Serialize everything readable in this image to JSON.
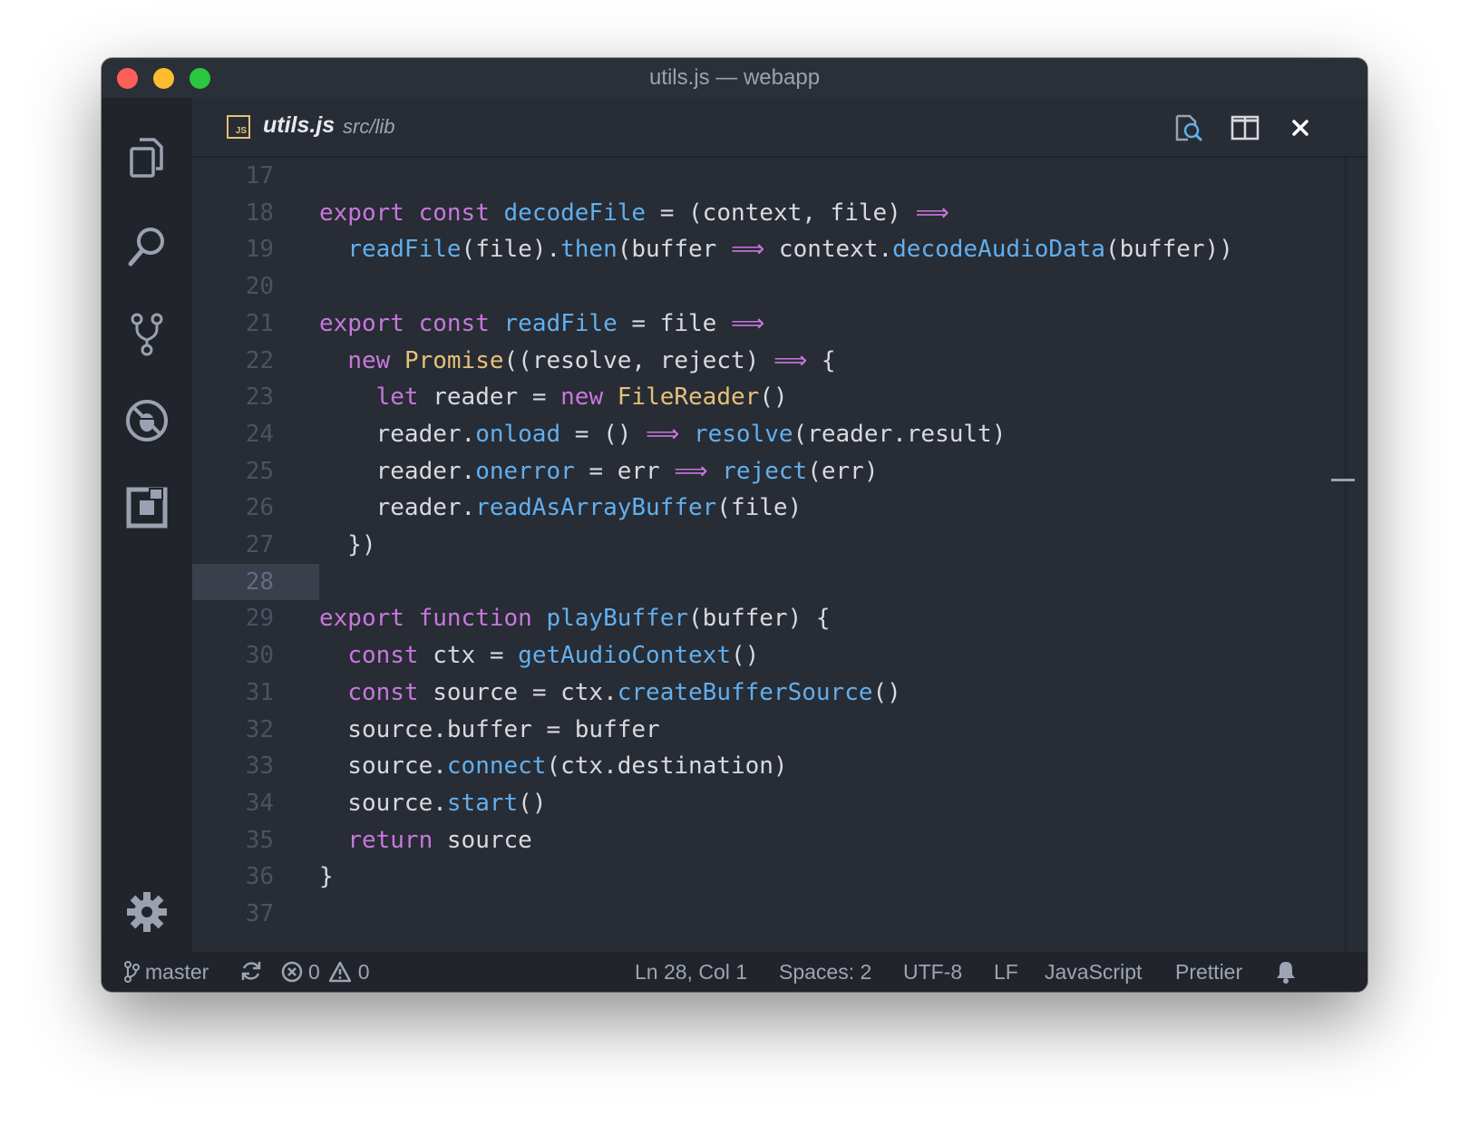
{
  "window": {
    "title": "utils.js — webapp"
  },
  "activity_bar": {
    "items": [
      {
        "icon": "files-icon"
      },
      {
        "icon": "search-icon"
      },
      {
        "icon": "source-control-icon"
      },
      {
        "icon": "debug-icon"
      },
      {
        "icon": "extensions-icon"
      }
    ],
    "settings_icon": "gear-icon"
  },
  "tab": {
    "file_icon_label": "JS",
    "file_name": "utils.js",
    "file_path": "src/lib",
    "actions": [
      "open-preview-icon",
      "split-editor-icon",
      "close-icon"
    ]
  },
  "editor": {
    "current_line": 28,
    "lines": [
      {
        "n": "17",
        "tokens": []
      },
      {
        "n": "18",
        "tokens": [
          [
            "kw",
            "export"
          ],
          [
            "pl",
            " "
          ],
          [
            "kw",
            "const"
          ],
          [
            "pl",
            " "
          ],
          [
            "fn",
            "decodeFile"
          ],
          [
            "pl",
            " = (context, file) "
          ],
          [
            "op",
            "⟹"
          ]
        ]
      },
      {
        "n": "19",
        "tokens": [
          [
            "pl",
            "  "
          ],
          [
            "fn",
            "readFile"
          ],
          [
            "pl",
            "(file)."
          ],
          [
            "fn",
            "then"
          ],
          [
            "pl",
            "(buffer "
          ],
          [
            "op",
            "⟹"
          ],
          [
            "pl",
            " context."
          ],
          [
            "fn",
            "decodeAudioData"
          ],
          [
            "pl",
            "(buffer))"
          ]
        ]
      },
      {
        "n": "20",
        "tokens": []
      },
      {
        "n": "21",
        "tokens": [
          [
            "kw",
            "export"
          ],
          [
            "pl",
            " "
          ],
          [
            "kw",
            "const"
          ],
          [
            "pl",
            " "
          ],
          [
            "fn",
            "readFile"
          ],
          [
            "pl",
            " = file "
          ],
          [
            "op",
            "⟹"
          ]
        ]
      },
      {
        "n": "22",
        "tokens": [
          [
            "pl",
            "  "
          ],
          [
            "kw",
            "new"
          ],
          [
            "pl",
            " "
          ],
          [
            "cls",
            "Promise"
          ],
          [
            "pl",
            "((resolve, reject) "
          ],
          [
            "op",
            "⟹"
          ],
          [
            "pl",
            " {"
          ]
        ]
      },
      {
        "n": "23",
        "tokens": [
          [
            "pl",
            "    "
          ],
          [
            "kw",
            "let"
          ],
          [
            "pl",
            " reader = "
          ],
          [
            "kw",
            "new"
          ],
          [
            "pl",
            " "
          ],
          [
            "cls",
            "FileReader"
          ],
          [
            "pl",
            "()"
          ]
        ]
      },
      {
        "n": "24",
        "tokens": [
          [
            "pl",
            "    reader."
          ],
          [
            "fn",
            "onload"
          ],
          [
            "pl",
            " = () "
          ],
          [
            "op",
            "⟹"
          ],
          [
            "pl",
            " "
          ],
          [
            "fn",
            "resolve"
          ],
          [
            "pl",
            "(reader.result)"
          ]
        ]
      },
      {
        "n": "25",
        "tokens": [
          [
            "pl",
            "    reader."
          ],
          [
            "fn",
            "onerror"
          ],
          [
            "pl",
            " = err "
          ],
          [
            "op",
            "⟹"
          ],
          [
            "pl",
            " "
          ],
          [
            "fn",
            "reject"
          ],
          [
            "pl",
            "(err)"
          ]
        ]
      },
      {
        "n": "26",
        "tokens": [
          [
            "pl",
            "    reader."
          ],
          [
            "fn",
            "readAsArrayBuffer"
          ],
          [
            "pl",
            "(file)"
          ]
        ]
      },
      {
        "n": "27",
        "tokens": [
          [
            "pl",
            "  })"
          ]
        ]
      },
      {
        "n": "28",
        "tokens": []
      },
      {
        "n": "29",
        "tokens": [
          [
            "kw",
            "export"
          ],
          [
            "pl",
            " "
          ],
          [
            "kw",
            "function"
          ],
          [
            "pl",
            " "
          ],
          [
            "fn",
            "playBuffer"
          ],
          [
            "pl",
            "(buffer) {"
          ]
        ]
      },
      {
        "n": "30",
        "tokens": [
          [
            "pl",
            "  "
          ],
          [
            "kw",
            "const"
          ],
          [
            "pl",
            " ctx = "
          ],
          [
            "fn",
            "getAudioContext"
          ],
          [
            "pl",
            "()"
          ]
        ]
      },
      {
        "n": "31",
        "tokens": [
          [
            "pl",
            "  "
          ],
          [
            "kw",
            "const"
          ],
          [
            "pl",
            " source = ctx."
          ],
          [
            "fn",
            "createBufferSource"
          ],
          [
            "pl",
            "()"
          ]
        ]
      },
      {
        "n": "32",
        "tokens": [
          [
            "pl",
            "  source.buffer = buffer"
          ]
        ]
      },
      {
        "n": "33",
        "tokens": [
          [
            "pl",
            "  source."
          ],
          [
            "fn",
            "connect"
          ],
          [
            "pl",
            "(ctx.destination)"
          ]
        ]
      },
      {
        "n": "34",
        "tokens": [
          [
            "pl",
            "  source."
          ],
          [
            "fn",
            "start"
          ],
          [
            "pl",
            "()"
          ]
        ]
      },
      {
        "n": "35",
        "tokens": [
          [
            "pl",
            "  "
          ],
          [
            "kw",
            "return"
          ],
          [
            "pl",
            " source"
          ]
        ]
      },
      {
        "n": "36",
        "tokens": [
          [
            "pl",
            "}"
          ]
        ]
      },
      {
        "n": "37",
        "tokens": []
      }
    ]
  },
  "status_bar": {
    "branch": "master",
    "errors": "0",
    "warnings": "0",
    "cursor": "Ln 28, Col 1",
    "indent": "Spaces: 2",
    "encoding": "UTF-8",
    "eol": "LF",
    "language": "JavaScript",
    "formatter": "Prettier"
  },
  "colors": {
    "keyword": "#c678dd",
    "function": "#61afef",
    "class": "#e5c07b",
    "plain": "#d7dae0",
    "background": "#282c34"
  }
}
